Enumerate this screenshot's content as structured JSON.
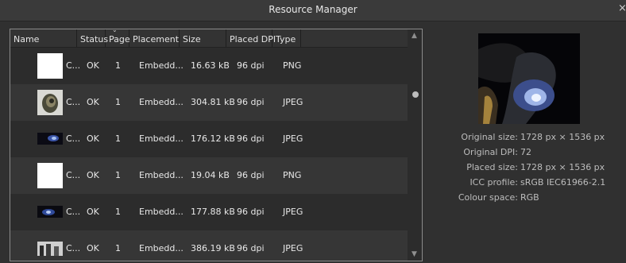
{
  "window": {
    "title": "Resource Manager",
    "close_glyph": "×"
  },
  "table": {
    "columns": [
      "Name",
      "Status",
      "Page",
      "Placement",
      "Size",
      "Placed DPI",
      "Type"
    ],
    "sort_glyph": "⌄",
    "rows": [
      {
        "name": "C...",
        "thumb": "white",
        "status": "OK",
        "page": "1",
        "placement": "Embedd...",
        "size": "16.63 kB",
        "dpi": "96 dpi",
        "type": "PNG"
      },
      {
        "name": "C...",
        "thumb": "portrait-dark",
        "status": "OK",
        "page": "1",
        "placement": "Embedd...",
        "size": "304.81 kB",
        "dpi": "96 dpi",
        "type": "JPEG"
      },
      {
        "name": "C...",
        "thumb": "wide-dark-blue",
        "status": "OK",
        "page": "1",
        "placement": "Embedd...",
        "size": "176.12 kB",
        "dpi": "96 dpi",
        "type": "JPEG"
      },
      {
        "name": "C...",
        "thumb": "white",
        "status": "OK",
        "page": "1",
        "placement": "Embedd...",
        "size": "19.04 kB",
        "dpi": "96 dpi",
        "type": "PNG"
      },
      {
        "name": "C...",
        "thumb": "wide-dark-blue",
        "status": "OK",
        "page": "1",
        "placement": "Embedd...",
        "size": "177.88 kB",
        "dpi": "96 dpi",
        "type": "JPEG"
      },
      {
        "name": "C...",
        "thumb": "grey-figures",
        "status": "OK",
        "page": "1",
        "placement": "Embedd...",
        "size": "386.19 kB",
        "dpi": "96 dpi",
        "type": "JPEG"
      }
    ]
  },
  "scrollbar": {
    "up_glyph": "▲",
    "down_glyph": "▼"
  },
  "details": [
    {
      "label": "Original size:",
      "value": "1728 px × 1536 px"
    },
    {
      "label": "Original DPI:",
      "value": "72"
    },
    {
      "label": "Placed size:",
      "value": "1728 px × 1536 px"
    },
    {
      "label": "ICC profile:",
      "value": "sRGB IEC61966-2.1"
    },
    {
      "label": "Colour space:",
      "value": "RGB"
    }
  ]
}
